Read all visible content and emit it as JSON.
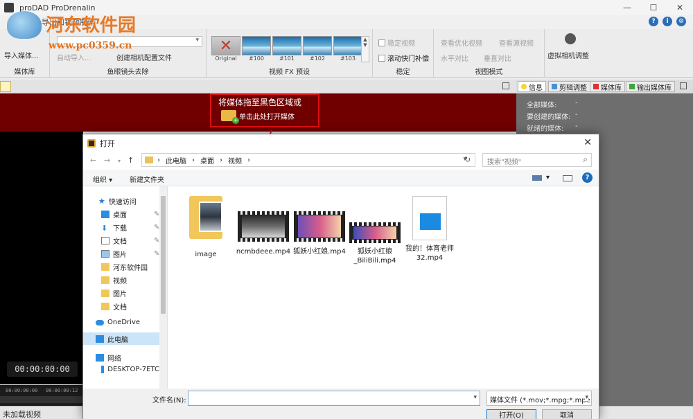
{
  "app": {
    "title": "proDAD ProDrenalin",
    "quick_label": "导出和视频制作"
  },
  "watermark": {
    "title": "河东软件园",
    "url": "www.pc0359.cn"
  },
  "ribbon": {
    "media_library": {
      "import_label": "导入媒体...",
      "group_label": "媒体库"
    },
    "fisheye": {
      "disabled_btn": "自动导入...",
      "create_config": "创建相机配置文件",
      "group_label": "鱼眼镜头去除"
    },
    "fx_presets": {
      "group_label": "视频 FX 预设",
      "items": [
        "Original",
        "#100",
        "#101",
        "#102",
        "#103"
      ]
    },
    "stabilize": {
      "stabilize_video": "稳定视频",
      "rolling_shutter": "滚动快门补偿",
      "group_label": "稳定"
    },
    "view_mode": {
      "view_optimized": "查看优化视频",
      "view_original": "查看源视频",
      "horizontal_compare": "水平对比",
      "vertical_compare": "垂直对比",
      "group_label": "视图模式"
    },
    "virtual_camera": {
      "label": "虚拟相机调整"
    }
  },
  "drop_area": {
    "hint": "将媒体拖至黑色区域或",
    "open_button": "单击此处打开媒体"
  },
  "player": {
    "timecode": "00:00:00:00",
    "timeline_marks": [
      "00:00:00:00",
      "00:00:00:12"
    ]
  },
  "status": {
    "text": "未加载视频"
  },
  "right_panel": {
    "tabs": [
      {
        "label": "信息",
        "color": "#f7d23d"
      },
      {
        "label": "剪辑调整",
        "color": "#4a90d9"
      },
      {
        "label": "媒体库",
        "color": "#e03030"
      },
      {
        "label": "输出媒体库",
        "color": "#39a839"
      }
    ],
    "info": [
      {
        "label": "全部媒体:",
        "value": "-"
      },
      {
        "label": "要创建的媒体:",
        "value": "-"
      },
      {
        "label": "就绪的媒体:",
        "value": "-"
      }
    ]
  },
  "dialog": {
    "title": "打开",
    "breadcrumb": [
      "此电脑",
      "桌面",
      "视频"
    ],
    "search_placeholder": "搜索\"视频\"",
    "organize": "组织 ▾",
    "new_folder": "新建文件夹",
    "nav": [
      {
        "label": "快速访问",
        "icon": "star-icon"
      },
      {
        "label": "桌面",
        "icon": "desktop-icon",
        "pinned": true
      },
      {
        "label": "下载",
        "icon": "download-icon",
        "pinned": true
      },
      {
        "label": "文档",
        "icon": "document-icon",
        "pinned": true
      },
      {
        "label": "图片",
        "icon": "picture-icon",
        "pinned": true
      },
      {
        "label": "河东软件园",
        "icon": "folder-icon"
      },
      {
        "label": "视频",
        "icon": "folder-icon"
      },
      {
        "label": "图片",
        "icon": "folder-icon"
      },
      {
        "label": "文档",
        "icon": "folder-icon"
      },
      {
        "label": "OneDrive",
        "icon": "cloud-icon"
      },
      {
        "label": "此电脑",
        "icon": "computer-icon"
      },
      {
        "label": "网络",
        "icon": "network-icon"
      },
      {
        "label": "DESKTOP-7ETC",
        "icon": "computer-icon"
      }
    ],
    "files": [
      {
        "name": "image",
        "type": "folder"
      },
      {
        "name": "ncmbdeee.mp4",
        "type": "video"
      },
      {
        "name": "狐妖小红娘.mp4",
        "type": "video"
      },
      {
        "name": "狐妖小红娘_BiliBili.mp4",
        "type": "video"
      },
      {
        "name": "我的！体育老师32.mp4",
        "type": "document"
      }
    ],
    "filename_label": "文件名(N):",
    "filename_value": "",
    "filter": "媒体文件 (*.mov;*.mpg;*.mpe",
    "open_button": "打开(O)",
    "cancel_button": "取消"
  }
}
